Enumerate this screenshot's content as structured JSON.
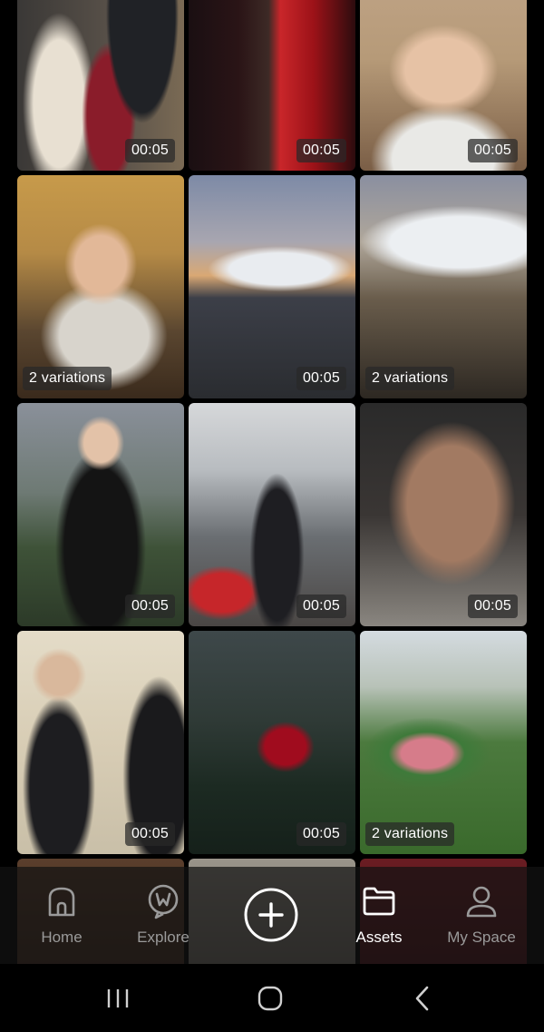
{
  "tiles": [
    {
      "label": "00:05",
      "type": "duration"
    },
    {
      "label": "00:05",
      "type": "duration"
    },
    {
      "label": "00:05",
      "type": "duration"
    },
    {
      "label": "2 variations",
      "type": "variations"
    },
    {
      "label": "00:05",
      "type": "duration"
    },
    {
      "label": "2 variations",
      "type": "variations"
    },
    {
      "label": "00:05",
      "type": "duration"
    },
    {
      "label": "00:05",
      "type": "duration"
    },
    {
      "label": "00:05",
      "type": "duration"
    },
    {
      "label": "00:05",
      "type": "duration"
    },
    {
      "label": "00:05",
      "type": "duration"
    },
    {
      "label": "2 variations",
      "type": "variations"
    }
  ],
  "nav": {
    "home": {
      "label": "Home",
      "icon": "home-icon"
    },
    "explore": {
      "label": "Explore",
      "icon": "explore-icon"
    },
    "create": {
      "icon": "plus-circle-icon"
    },
    "assets": {
      "label": "Assets",
      "icon": "folder-icon",
      "active": true
    },
    "myspace": {
      "label": "My Space",
      "icon": "user-icon"
    }
  },
  "system_nav": {
    "recent": "recent-apps-icon",
    "home": "home-circle-icon",
    "back": "back-chevron-icon"
  },
  "colors": {
    "nav_active": "#ffffff",
    "nav_inactive": "#9a9a9a",
    "label_bg": "#282828"
  }
}
